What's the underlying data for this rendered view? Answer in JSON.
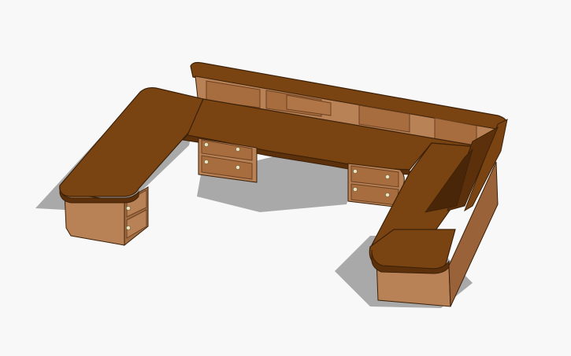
{
  "scene": {
    "subject": "u-shaped-desk",
    "background_color": "#f8f8f8",
    "shadow_color": "#a9a9a9",
    "colors": {
      "top": "#7a4412",
      "top_edge": "#5c300a",
      "top_deep": "#4a2608",
      "cabinet_face": "#b88256",
      "cabinet_dark": "#8a5a34",
      "panel": "#a86d3e",
      "outline": "#3b2008",
      "knob": "#e8e2c4"
    }
  }
}
